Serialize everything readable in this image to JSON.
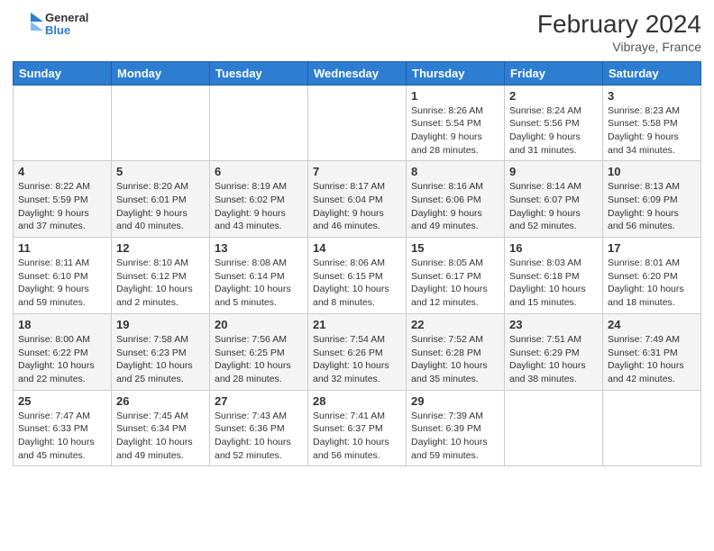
{
  "header": {
    "logo_general": "General",
    "logo_blue": "Blue",
    "month_year": "February 2024",
    "location": "Vibraye, France"
  },
  "days_of_week": [
    "Sunday",
    "Monday",
    "Tuesday",
    "Wednesday",
    "Thursday",
    "Friday",
    "Saturday"
  ],
  "weeks": [
    [
      {
        "day": "",
        "info": ""
      },
      {
        "day": "",
        "info": ""
      },
      {
        "day": "",
        "info": ""
      },
      {
        "day": "",
        "info": ""
      },
      {
        "day": "1",
        "info": "Sunrise: 8:26 AM\nSunset: 5:54 PM\nDaylight: 9 hours and 28 minutes."
      },
      {
        "day": "2",
        "info": "Sunrise: 8:24 AM\nSunset: 5:56 PM\nDaylight: 9 hours and 31 minutes."
      },
      {
        "day": "3",
        "info": "Sunrise: 8:23 AM\nSunset: 5:58 PM\nDaylight: 9 hours and 34 minutes."
      }
    ],
    [
      {
        "day": "4",
        "info": "Sunrise: 8:22 AM\nSunset: 5:59 PM\nDaylight: 9 hours and 37 minutes."
      },
      {
        "day": "5",
        "info": "Sunrise: 8:20 AM\nSunset: 6:01 PM\nDaylight: 9 hours and 40 minutes."
      },
      {
        "day": "6",
        "info": "Sunrise: 8:19 AM\nSunset: 6:02 PM\nDaylight: 9 hours and 43 minutes."
      },
      {
        "day": "7",
        "info": "Sunrise: 8:17 AM\nSunset: 6:04 PM\nDaylight: 9 hours and 46 minutes."
      },
      {
        "day": "8",
        "info": "Sunrise: 8:16 AM\nSunset: 6:06 PM\nDaylight: 9 hours and 49 minutes."
      },
      {
        "day": "9",
        "info": "Sunrise: 8:14 AM\nSunset: 6:07 PM\nDaylight: 9 hours and 52 minutes."
      },
      {
        "day": "10",
        "info": "Sunrise: 8:13 AM\nSunset: 6:09 PM\nDaylight: 9 hours and 56 minutes."
      }
    ],
    [
      {
        "day": "11",
        "info": "Sunrise: 8:11 AM\nSunset: 6:10 PM\nDaylight: 9 hours and 59 minutes."
      },
      {
        "day": "12",
        "info": "Sunrise: 8:10 AM\nSunset: 6:12 PM\nDaylight: 10 hours and 2 minutes."
      },
      {
        "day": "13",
        "info": "Sunrise: 8:08 AM\nSunset: 6:14 PM\nDaylight: 10 hours and 5 minutes."
      },
      {
        "day": "14",
        "info": "Sunrise: 8:06 AM\nSunset: 6:15 PM\nDaylight: 10 hours and 8 minutes."
      },
      {
        "day": "15",
        "info": "Sunrise: 8:05 AM\nSunset: 6:17 PM\nDaylight: 10 hours and 12 minutes."
      },
      {
        "day": "16",
        "info": "Sunrise: 8:03 AM\nSunset: 6:18 PM\nDaylight: 10 hours and 15 minutes."
      },
      {
        "day": "17",
        "info": "Sunrise: 8:01 AM\nSunset: 6:20 PM\nDaylight: 10 hours and 18 minutes."
      }
    ],
    [
      {
        "day": "18",
        "info": "Sunrise: 8:00 AM\nSunset: 6:22 PM\nDaylight: 10 hours and 22 minutes."
      },
      {
        "day": "19",
        "info": "Sunrise: 7:58 AM\nSunset: 6:23 PM\nDaylight: 10 hours and 25 minutes."
      },
      {
        "day": "20",
        "info": "Sunrise: 7:56 AM\nSunset: 6:25 PM\nDaylight: 10 hours and 28 minutes."
      },
      {
        "day": "21",
        "info": "Sunrise: 7:54 AM\nSunset: 6:26 PM\nDaylight: 10 hours and 32 minutes."
      },
      {
        "day": "22",
        "info": "Sunrise: 7:52 AM\nSunset: 6:28 PM\nDaylight: 10 hours and 35 minutes."
      },
      {
        "day": "23",
        "info": "Sunrise: 7:51 AM\nSunset: 6:29 PM\nDaylight: 10 hours and 38 minutes."
      },
      {
        "day": "24",
        "info": "Sunrise: 7:49 AM\nSunset: 6:31 PM\nDaylight: 10 hours and 42 minutes."
      }
    ],
    [
      {
        "day": "25",
        "info": "Sunrise: 7:47 AM\nSunset: 6:33 PM\nDaylight: 10 hours and 45 minutes."
      },
      {
        "day": "26",
        "info": "Sunrise: 7:45 AM\nSunset: 6:34 PM\nDaylight: 10 hours and 49 minutes."
      },
      {
        "day": "27",
        "info": "Sunrise: 7:43 AM\nSunset: 6:36 PM\nDaylight: 10 hours and 52 minutes."
      },
      {
        "day": "28",
        "info": "Sunrise: 7:41 AM\nSunset: 6:37 PM\nDaylight: 10 hours and 56 minutes."
      },
      {
        "day": "29",
        "info": "Sunrise: 7:39 AM\nSunset: 6:39 PM\nDaylight: 10 hours and 59 minutes."
      },
      {
        "day": "",
        "info": ""
      },
      {
        "day": "",
        "info": ""
      }
    ]
  ]
}
